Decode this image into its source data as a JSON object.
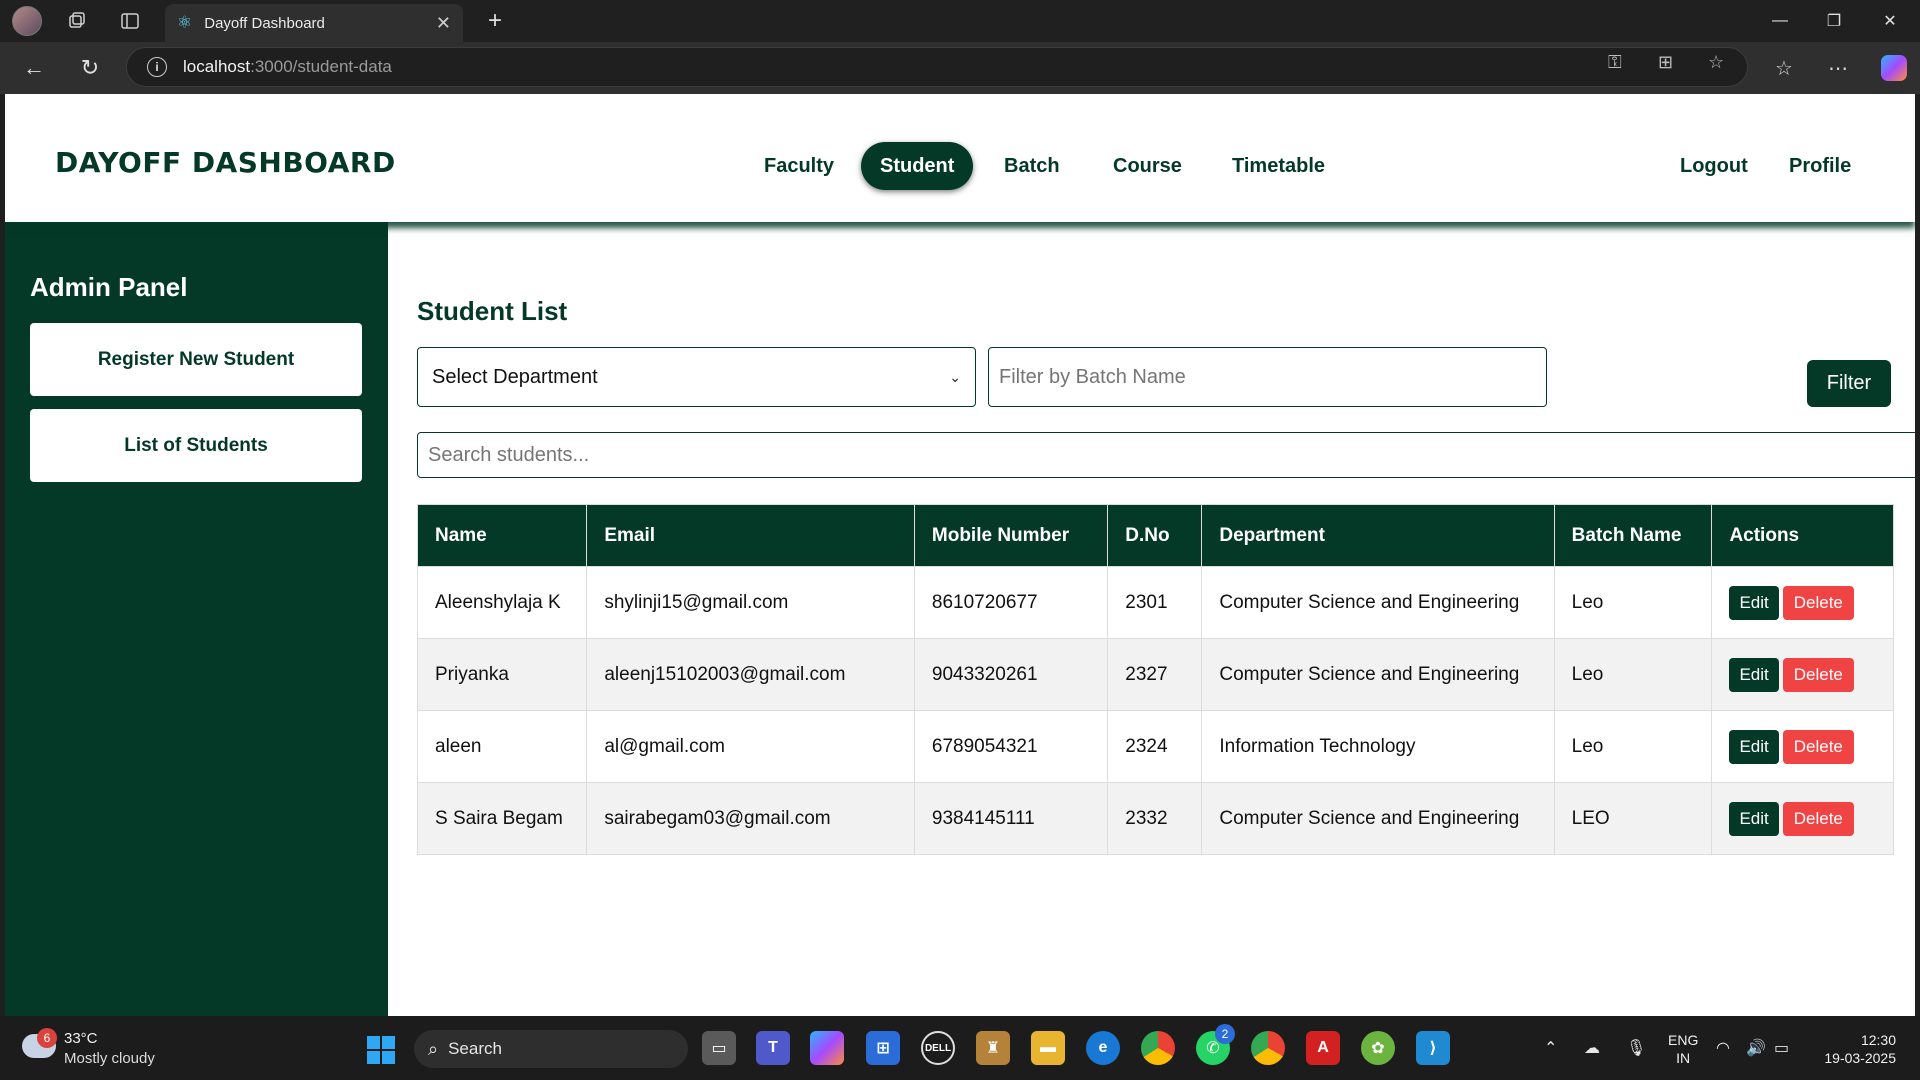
{
  "browser": {
    "tab_title": "Dayoff Dashboard",
    "url_host": "localhost",
    "url_path": ":3000/student-data"
  },
  "header": {
    "brand": "DAYOFF DASHBOARD",
    "nav": [
      "Faculty",
      "Student",
      "Batch",
      "Course",
      "Timetable"
    ],
    "active_nav": "Student",
    "right_links": [
      "Logout",
      "Profile"
    ]
  },
  "sidebar": {
    "title": "Admin Panel",
    "buttons": [
      "Register New Student",
      "List of Students"
    ]
  },
  "main": {
    "title": "Student List",
    "department_select": "Select Department",
    "batch_filter_placeholder": "Filter by Batch Name",
    "filter_button": "Filter",
    "search_placeholder": "Search students...",
    "table": {
      "headers": [
        "Name",
        "Email",
        "Mobile Number",
        "D.No",
        "Department",
        "Batch Name",
        "Actions"
      ],
      "rows": [
        [
          "Aleenshylaja K",
          "shylinji15@gmail.com",
          "8610720677",
          "2301",
          "Computer Science and Engineering",
          "Leo"
        ],
        [
          "Priyanka",
          "aleenj15102003@gmail.com",
          "9043320261",
          "2327",
          "Computer Science and Engineering",
          "Leo"
        ],
        [
          "aleen",
          "al@gmail.com",
          "6789054321",
          "2324",
          "Information Technology",
          "Leo"
        ],
        [
          "S Saira Begam",
          "sairabegam03@gmail.com",
          "9384145111",
          "2332",
          "Computer Science and Engineering",
          "LEO"
        ]
      ],
      "edit_label": "Edit",
      "delete_label": "Delete"
    }
  },
  "taskbar": {
    "weather_badge": "6",
    "temperature": "33°C",
    "weather": "Mostly cloudy",
    "search": "Search",
    "whatsapp_badge": "2",
    "lang_top": "ENG",
    "lang_bottom": "IN",
    "time": "12:30",
    "date": "19-03-2025"
  },
  "colors": {
    "brand_green": "#043827",
    "delete_red": "#f04343"
  }
}
